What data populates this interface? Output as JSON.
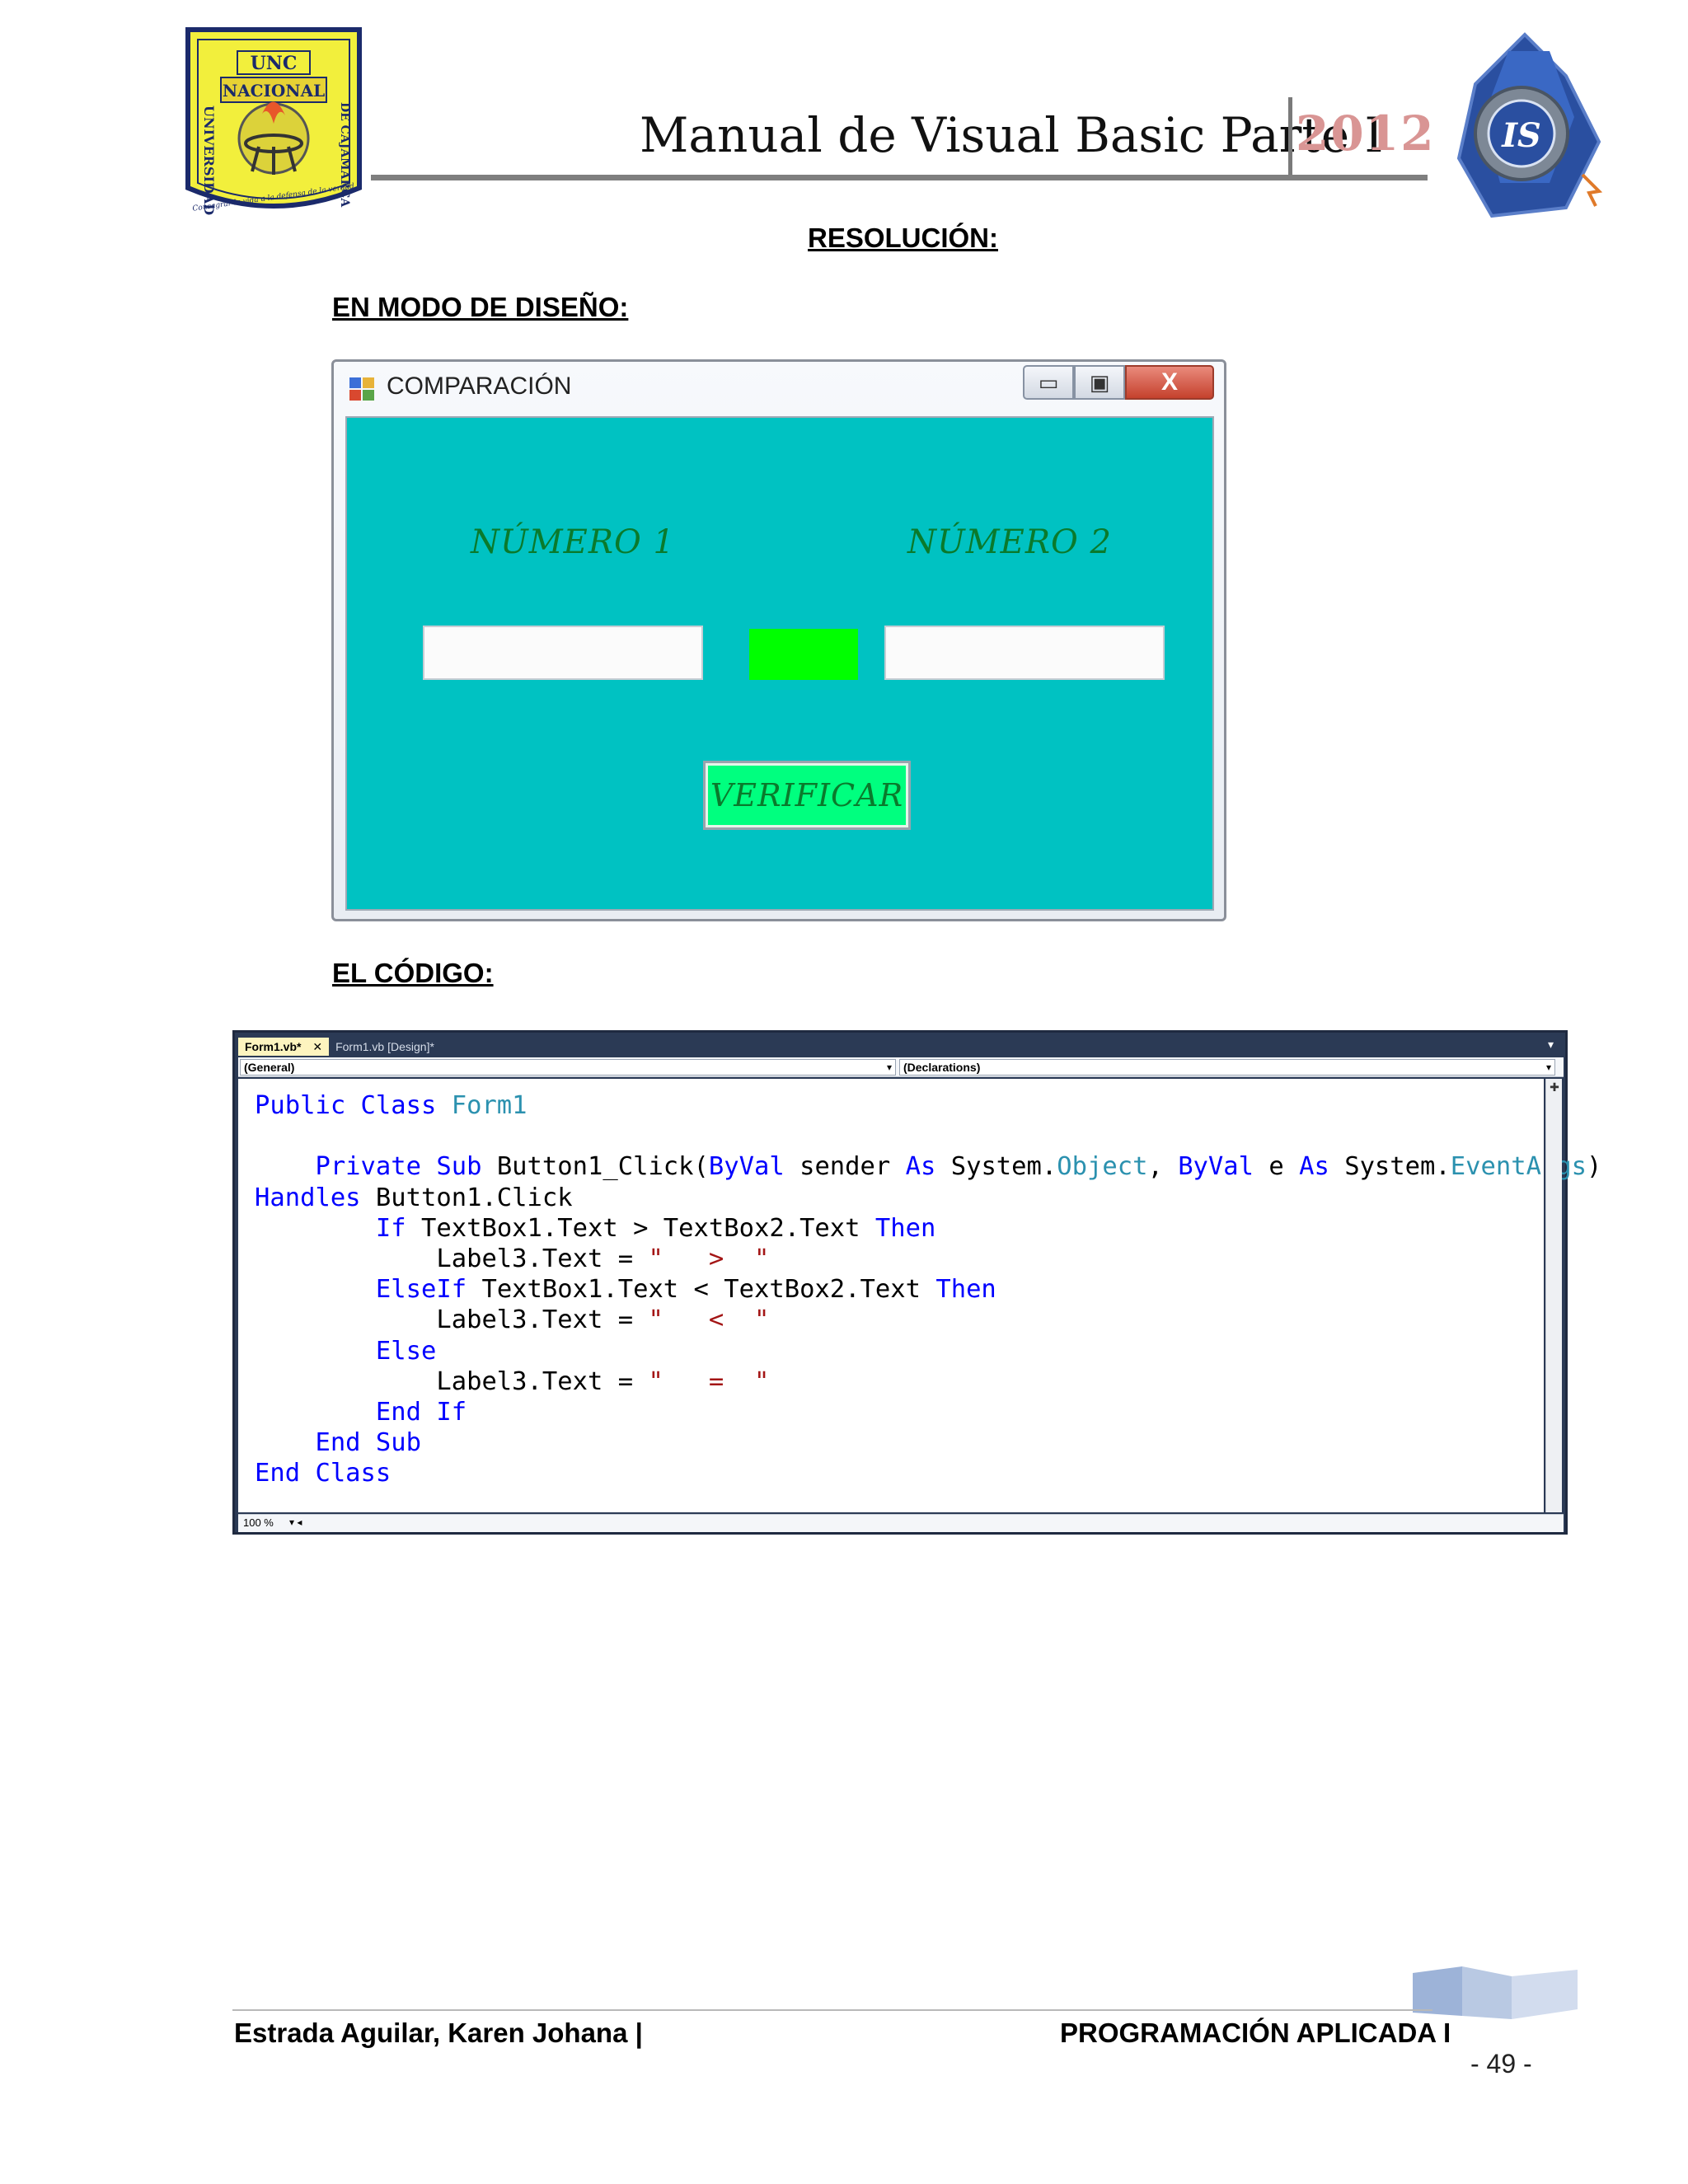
{
  "header": {
    "title": "Manual de Visual Basic Parte I",
    "year": "2012",
    "left_logo": {
      "top_text": "UNC",
      "name_text": "NACIONAL",
      "left_side": "UNIVERSIDAD",
      "right_side": "DE CAJAMARCA",
      "motto": "Consagrar la vida a la defensa de la verdad"
    },
    "right_logo": {
      "emblem_text": "IS"
    }
  },
  "headings": {
    "resolucion": "RESOLUCIÓN:",
    "modo_diseno": "EN MODO DE DISEÑO:",
    "codigo": "EL CÓDIGO:"
  },
  "form_window": {
    "title": "COMPARACIÓN",
    "buttons": {
      "minimize": "▭",
      "maximize": "▣",
      "close": "X"
    },
    "label_numero1": "NÚMERO 1",
    "label_numero2": "NÚMERO 2",
    "button_verificar": "VERIFICAR",
    "colors": {
      "background": "#00c2c2",
      "label3": "#00ff00",
      "button": "#00ff7f",
      "label_text": "#0a7a2c"
    }
  },
  "code_editor": {
    "tabs": [
      {
        "label": "Form1.vb*",
        "close": "✕",
        "active": true
      },
      {
        "label": "Form1.vb [Design]*",
        "active": false
      }
    ],
    "combo_general": "(General)",
    "combo_declarations": "(Declarations)",
    "zoom": "100 %",
    "colors": {
      "keyword": "#0000ff",
      "type": "#2b91af",
      "string": "#a31515"
    },
    "lines": [
      [
        {
          "t": "kw",
          "v": "Public Class "
        },
        {
          "t": "ty",
          "v": "Form1"
        }
      ],
      [],
      [
        {
          "t": "",
          "v": "    "
        },
        {
          "t": "kw",
          "v": "Private Sub "
        },
        {
          "t": "",
          "v": "Button1_Click("
        },
        {
          "t": "kw",
          "v": "ByVal "
        },
        {
          "t": "",
          "v": "sender "
        },
        {
          "t": "kw",
          "v": "As "
        },
        {
          "t": "",
          "v": "System."
        },
        {
          "t": "ty",
          "v": "Object"
        },
        {
          "t": "",
          "v": ", "
        },
        {
          "t": "kw",
          "v": "ByVal "
        },
        {
          "t": "",
          "v": "e "
        },
        {
          "t": "kw",
          "v": "As "
        },
        {
          "t": "",
          "v": "System."
        },
        {
          "t": "ty",
          "v": "EventArgs"
        },
        {
          "t": "",
          "v": ")"
        }
      ],
      [
        {
          "t": "kw",
          "v": "Handles "
        },
        {
          "t": "",
          "v": "Button1.Click"
        }
      ],
      [
        {
          "t": "",
          "v": "        "
        },
        {
          "t": "kw",
          "v": "If "
        },
        {
          "t": "",
          "v": "TextBox1.Text > TextBox2.Text "
        },
        {
          "t": "kw",
          "v": "Then"
        }
      ],
      [
        {
          "t": "",
          "v": "            Label3.Text = "
        },
        {
          "t": "st",
          "v": "\"   >  \""
        }
      ],
      [
        {
          "t": "",
          "v": "        "
        },
        {
          "t": "kw",
          "v": "ElseIf "
        },
        {
          "t": "",
          "v": "TextBox1.Text < TextBox2.Text "
        },
        {
          "t": "kw",
          "v": "Then"
        }
      ],
      [
        {
          "t": "",
          "v": "            Label3.Text = "
        },
        {
          "t": "st",
          "v": "\"   <  \""
        }
      ],
      [
        {
          "t": "",
          "v": "        "
        },
        {
          "t": "kw",
          "v": "Else"
        }
      ],
      [
        {
          "t": "",
          "v": "            Label3.Text = "
        },
        {
          "t": "st",
          "v": "\"   =  \""
        }
      ],
      [
        {
          "t": "",
          "v": "        "
        },
        {
          "t": "kw",
          "v": "End If"
        }
      ],
      [
        {
          "t": "",
          "v": "    "
        },
        {
          "t": "kw",
          "v": "End Sub"
        }
      ],
      [
        {
          "t": "kw",
          "v": "End Class"
        }
      ]
    ]
  },
  "footer": {
    "author": "Estrada Aguilar, Karen Johana |",
    "course": "PROGRAMACIÓN APLICADA I",
    "page": "- 49 -"
  }
}
